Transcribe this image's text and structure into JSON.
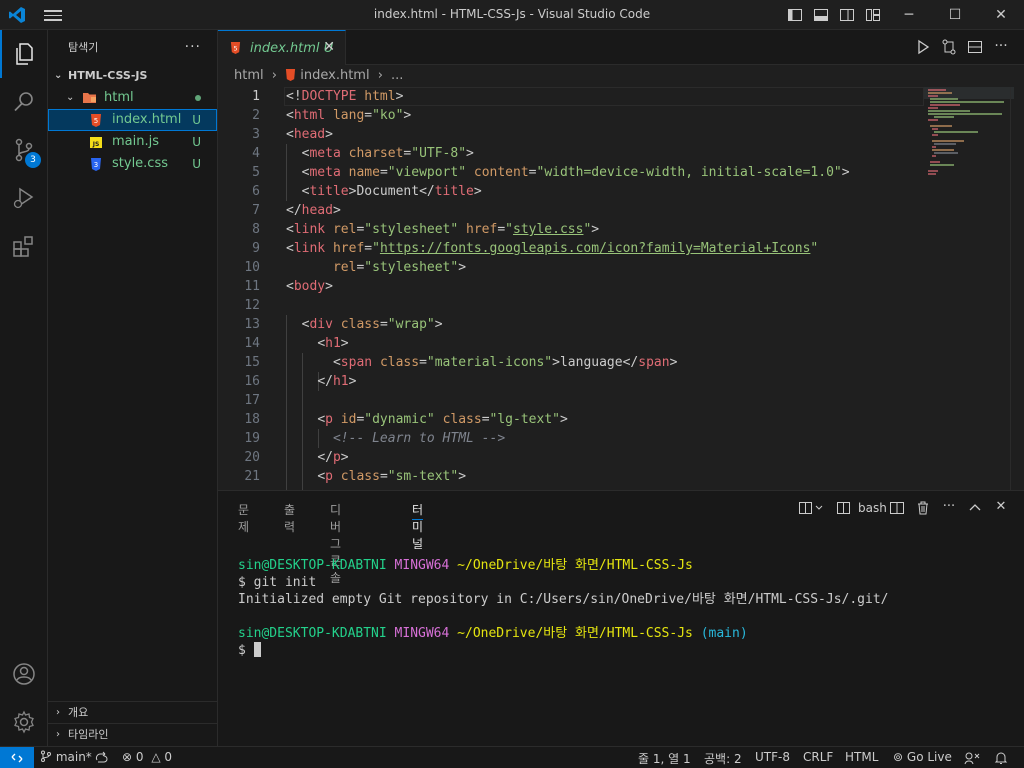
{
  "window": {
    "title": "index.html - HTML-CSS-Js - Visual Studio Code"
  },
  "activity_bar": {
    "scm_badge": "3"
  },
  "sidebar": {
    "title": "탐색기",
    "more": "···",
    "root": "HTML-CSS-JS",
    "folder": "html",
    "files": [
      {
        "name": "index.html",
        "status": "U",
        "icon": "html-icon"
      },
      {
        "name": "main.js",
        "status": "U",
        "icon": "js-icon"
      },
      {
        "name": "style.css",
        "status": "U",
        "icon": "css-icon"
      }
    ],
    "outline": "개요",
    "timeline": "타임라인"
  },
  "editor": {
    "tab": {
      "name": "index.html",
      "status": "U"
    },
    "breadcrumb": [
      "html",
      "index.html",
      "..."
    ],
    "current_line": 1,
    "line_numbers": [
      "1",
      "2",
      "3",
      "4",
      "5",
      "6",
      "7",
      "8",
      "9",
      "10",
      "11",
      "12",
      "13",
      "14",
      "15",
      "16",
      "17",
      "18",
      "19",
      "20",
      "21"
    ]
  },
  "panel": {
    "tabs": [
      "문제",
      "출력",
      "디버그 콘솔",
      "터미널"
    ],
    "active_tab": "터미널",
    "shell": "bash",
    "terminal": {
      "prompt1_user": "sin@DESKTOP-KDABTNI",
      "prompt1_msys": "MINGW64",
      "prompt1_path": "~/OneDrive/바탕 화면/HTML-CSS-Js",
      "cmd1": "$ git init",
      "output1": "Initialized empty Git repository in C:/Users/sin/OneDrive/바탕 화면/HTML-CSS-Js/.git/",
      "prompt2_user": "sin@DESKTOP-KDABTNI",
      "prompt2_msys": "MINGW64",
      "prompt2_path": "~/OneDrive/바탕 화면/HTML-CSS-Js",
      "prompt2_branch": "(main)",
      "prompt_char": "$"
    }
  },
  "status_bar": {
    "branch": "main*",
    "errors": "0",
    "warnings": "0",
    "position": "줄 1, 열 1",
    "spaces": "공백: 2",
    "encoding": "UTF-8",
    "eol": "CRLF",
    "language": "HTML",
    "golive": "Go Live"
  },
  "colors": {
    "accent": "#0078d4",
    "untracked": "#73c991"
  }
}
